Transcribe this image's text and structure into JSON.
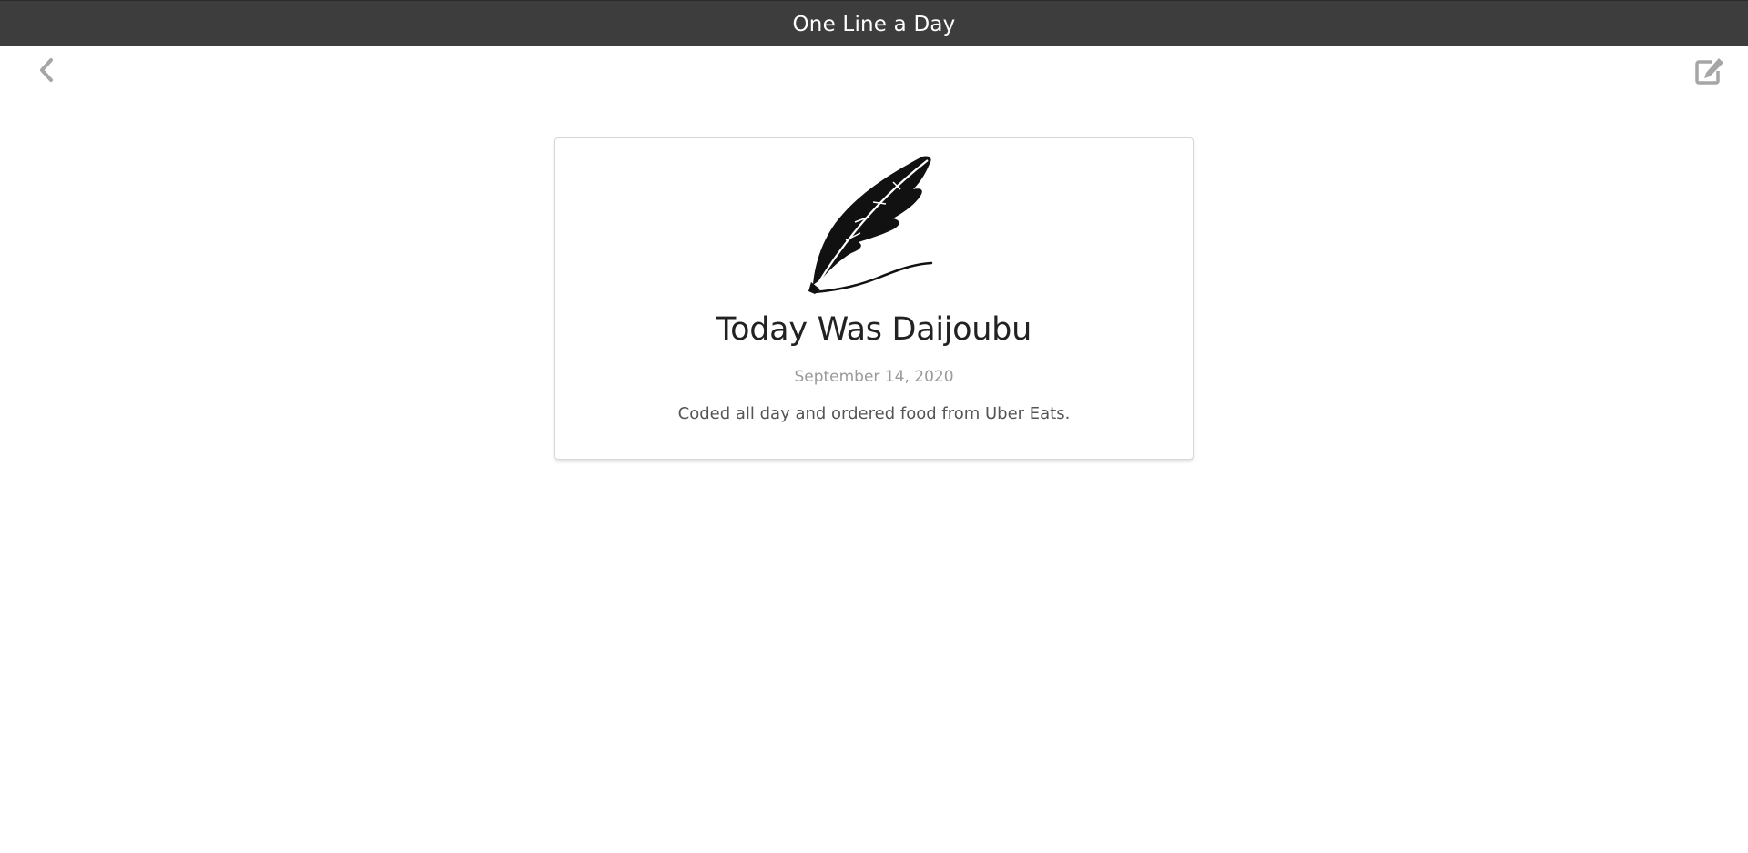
{
  "header": {
    "title": "One Line a Day"
  },
  "nav": {
    "back_icon": "chevron-left-icon",
    "edit_icon": "edit-icon"
  },
  "entry": {
    "logo_icon": "quill-pen-icon",
    "title": "Today Was Daijoubu",
    "date": "September 14, 2020",
    "text": "Coded all day and ordered food from Uber Eats."
  },
  "colors": {
    "header_bg": "#3d3d3d",
    "header_text": "#ffffff",
    "icon_gray": "#a6a6a6",
    "title_text": "#222222",
    "date_text": "#9a9a9a",
    "body_text": "#555555"
  }
}
